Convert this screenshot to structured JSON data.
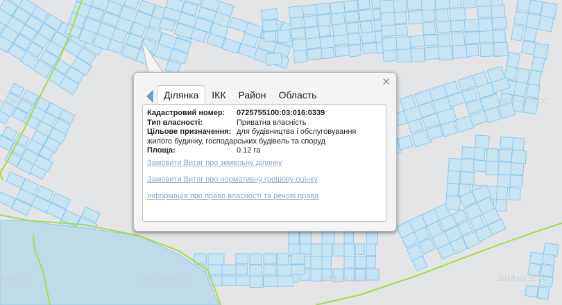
{
  "map": {
    "background": "#e4e5e6",
    "parcel_fill": "#c8e4f3",
    "parcel_stroke": "#8cc8ee",
    "boundary_color": "#a6dc4a",
    "water_fill": "#c0dbe8",
    "watermark_text": "2018.ua.SLCC"
  },
  "popup": {
    "close_icon": "close-icon",
    "prev_icon": "triangle-left-icon",
    "tabs": [
      "Ділянка",
      "ІКК",
      "Район",
      "Область"
    ],
    "active_tab": "Ділянка",
    "fields": {
      "cadastral_label": "Кадастровий номер:",
      "cadastral_value": "0725755100:03:016:0339",
      "ownership_label": "Тип власності:",
      "ownership_value": "Приватна власність",
      "purpose_label": "Цільове призначення:",
      "purpose_value_1": "для будівництва і обслуговування",
      "purpose_value_2": "жилого будинку, господарських будівель та споруд",
      "area_label": "Площа:",
      "area_value": "0.12 га"
    },
    "links": [
      "Замовити Витяг про земельну ділянку",
      "Замовити Витяг про нормативну грошову оцінку",
      "Інформація про право власності та речові права"
    ],
    "link_color": "#8fa6c9"
  }
}
